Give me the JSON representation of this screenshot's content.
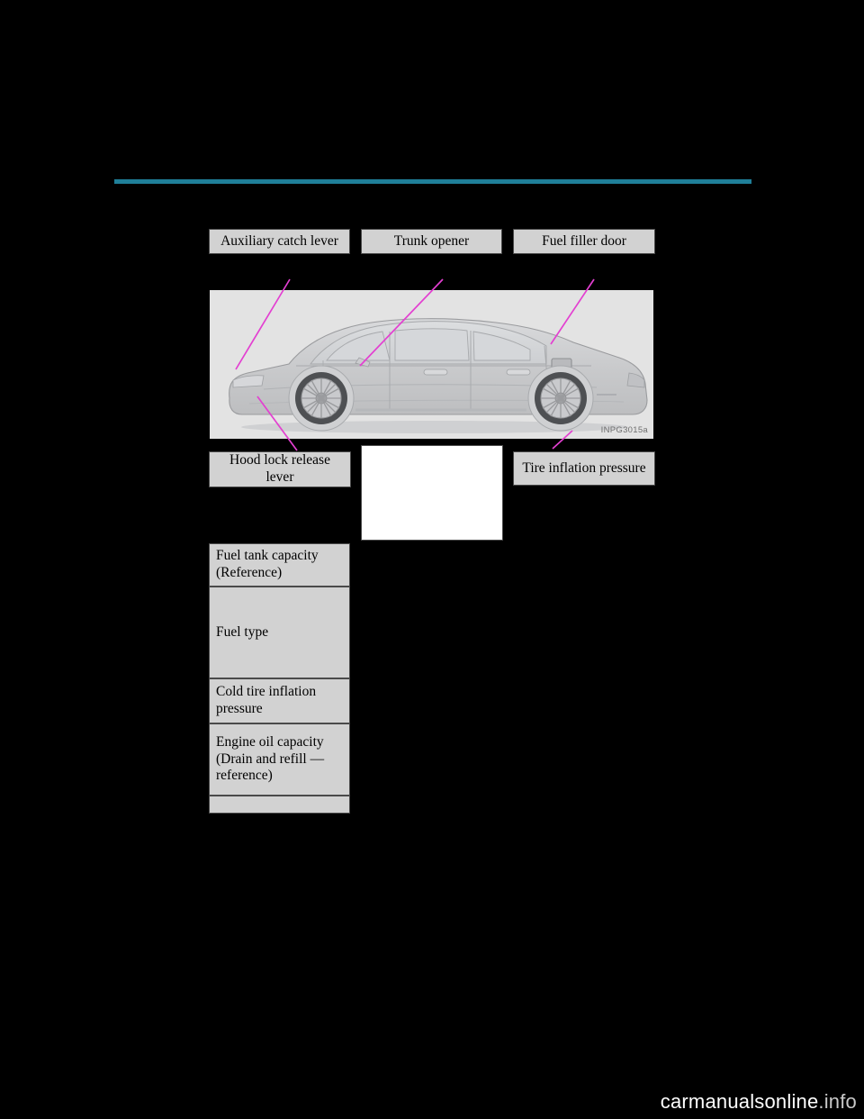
{
  "page": {
    "background_color": "#000000",
    "rule_color": "#1f7f99",
    "box_fill": "#d2d2d2",
    "box_border": "#4a4a4a",
    "photo_bg": "#e3e3e3",
    "leader_color": "#e33fd1",
    "image_code": "INPG3015a",
    "watermark": "carmanualsonline",
    "watermark_suffix": ".info"
  },
  "callouts": {
    "auxiliary_catch_lever": "Auxiliary catch lever",
    "trunk_opener": "Trunk opener",
    "fuel_filler_door": "Fuel filler door",
    "hood_lock_release_lever": "Hood lock release\nlever",
    "hood_lock_release_lever_line1": "Hood lock release",
    "hood_lock_release_lever_line2": "lever",
    "tire_inflation_pressure": "Tire inflation pressure",
    "blank_box": ""
  },
  "spec_table": {
    "rows": [
      {
        "label": "Fuel tank capacity\n(Reference)",
        "line1": "Fuel tank capacity",
        "line2": "(Reference)"
      },
      {
        "label": "Fuel type",
        "line1": "Fuel type",
        "line2": ""
      },
      {
        "label": "Cold tire inflation\npressure",
        "line1": "Cold tire inflation",
        "line2": "pressure"
      },
      {
        "label": "Engine oil capacity\n(Drain and refill —\nreference)",
        "line1": "Engine oil capacity",
        "line2": "(Drain and refill —",
        "line3": "reference)"
      },
      {
        "label": "",
        "line1": "",
        "line2": ""
      }
    ]
  }
}
